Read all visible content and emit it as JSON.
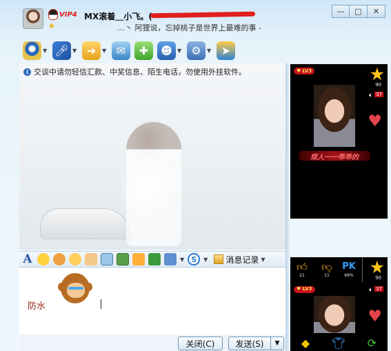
{
  "title_bar": {
    "vip_badge": "VIP4",
    "nickname": "MX滚着＿小飞。(",
    "signature": "…丶 阿狸说，忘掉桃子是世界上最难的事 -",
    "minimize_symbol": "—",
    "maximize_symbol": "□",
    "close_symbol": "✕"
  },
  "toolbar": {
    "icons": [
      "webcam-icon",
      "microphone-icon",
      "folder-icon",
      "picture-icon",
      "add-icon",
      "contact-icon",
      "settings-icon",
      "app-icon"
    ]
  },
  "chat": {
    "notice_icon": "i",
    "notice": "交谈中请勿轻信汇款、中奖信息、陌生电话，勿使用外挂软件。"
  },
  "format_toolbar": {
    "font_label": "A",
    "history_label": "消息记录"
  },
  "input": {
    "text": "防水"
  },
  "buttons": {
    "close_label": "关闭(C)",
    "send_label": "发送(S)",
    "send_arrow": "▼"
  },
  "show_panel": {
    "level": "LV3",
    "star_count": "90",
    "volume": "37",
    "banner": "烦人一一乖乖的"
  },
  "show_panel2": {
    "likes": "21",
    "dislikes": "11",
    "pk_percent": "69%",
    "level": "LV3",
    "star_count": "90",
    "volume": "37"
  },
  "colors": {
    "accent": "#2e6fc0",
    "redaction": "#e01f1f",
    "input_text": "#9a2a1a"
  }
}
